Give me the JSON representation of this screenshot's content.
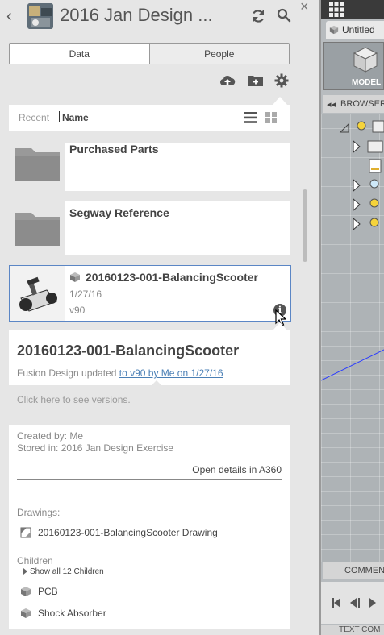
{
  "header": {
    "title": "2016 Jan Design ...",
    "back_icon": "chevron-left-icon",
    "refresh_icon": "refresh-icon",
    "search_icon": "search-icon",
    "close_label": "×"
  },
  "tabs": [
    {
      "label": "Data",
      "active": true
    },
    {
      "label": "People",
      "active": false
    }
  ],
  "toolbar": {
    "upload_icon": "cloud-upload-icon",
    "new_folder_icon": "new-folder-icon",
    "settings_icon": "gear-icon"
  },
  "sort": {
    "recent_label": "Recent",
    "name_label": "Name",
    "list_view_icon": "list-view-icon",
    "grid_view_icon": "grid-view-icon"
  },
  "folders": [
    {
      "name": "Purchased Parts"
    },
    {
      "name": "Segway Reference"
    }
  ],
  "selected_item": {
    "name": "20160123-001-BalancingScooter",
    "date": "1/27/16",
    "version": "v90",
    "info_label": "i"
  },
  "details": {
    "title": "20160123-001-BalancingScooter",
    "updated_prefix": "Fusion Design updated",
    "updated_link": "to v90 by Me on 1/27/16",
    "versions_link": "Click here to see versions."
  },
  "info": {
    "created_by": "Created by: Me",
    "stored_in": "Stored in: 2016 Jan Design Exercise",
    "open_details": "Open details in A360",
    "drawings_label": "Drawings:",
    "drawing_name": "20160123-001-BalancingScooter Drawing",
    "children_label": "Children",
    "show_all": "Show all 12 Children",
    "children": [
      "PCB",
      "Shock Absorber"
    ]
  },
  "right_panel": {
    "doc_tab": "Untitled",
    "model_label": "MODEL",
    "browser_label": "BROWSER",
    "comments_label": "COMMENT",
    "bottom_label": "TEXT COM"
  },
  "colors": {
    "panel_bg": "#e6e6e6",
    "card_bg": "#ffffff",
    "selected_border": "#5b86c5",
    "link": "#4a7fb5"
  }
}
